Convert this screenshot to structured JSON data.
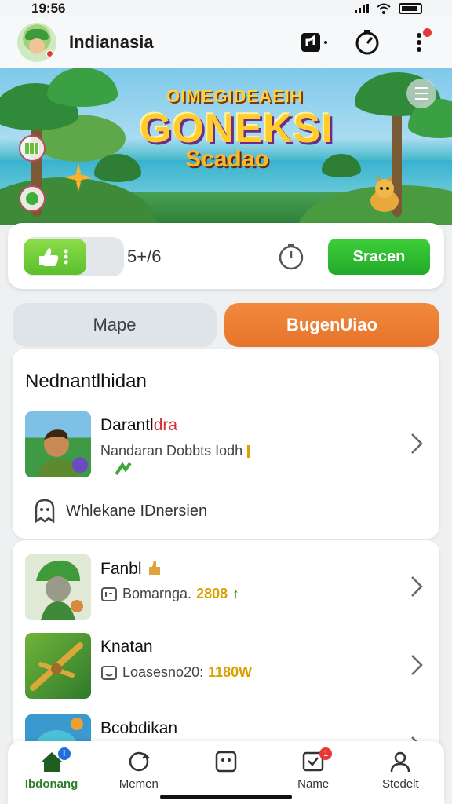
{
  "status_bar": {
    "time": "19:56"
  },
  "header": {
    "title": "Indianasia"
  },
  "banner": {
    "logo_top": "OIMEGIDEAEIH",
    "logo_main": "GONEKSI",
    "logo_sub": "Scadao"
  },
  "stats": {
    "score": "5+/6",
    "scan_label": "Sracen"
  },
  "tabs": {
    "left": "Mape",
    "right": "BugenUiao"
  },
  "section1": {
    "title": "Nednantlhidan",
    "item": {
      "title": "Darantl",
      "title_accent": "dra",
      "subtitle": "Nandaran Dobbts Iodh"
    },
    "footer": "Whlekane IDnersien"
  },
  "section2": {
    "items": [
      {
        "title": "Fanbl",
        "subtitle": "Bomarnga.",
        "value": "2808"
      },
      {
        "title": "Knatan",
        "subtitle": "Loasesno20:",
        "value": "1180W"
      },
      {
        "title": "Bcobdikan",
        "subtitle": "",
        "value": ""
      }
    ]
  },
  "bottom_nav": {
    "items": [
      {
        "label": "Ibdonang",
        "badge": "i",
        "badge_color": "#1e6fd9"
      },
      {
        "label": "Memen"
      },
      {
        "label": ""
      },
      {
        "label": "Name",
        "badge": "1",
        "badge_color": "#e53935"
      },
      {
        "label": "Stedelt"
      }
    ]
  },
  "colors": {
    "accent_green": "#2fb52c",
    "accent_orange": "#ee7f34"
  }
}
